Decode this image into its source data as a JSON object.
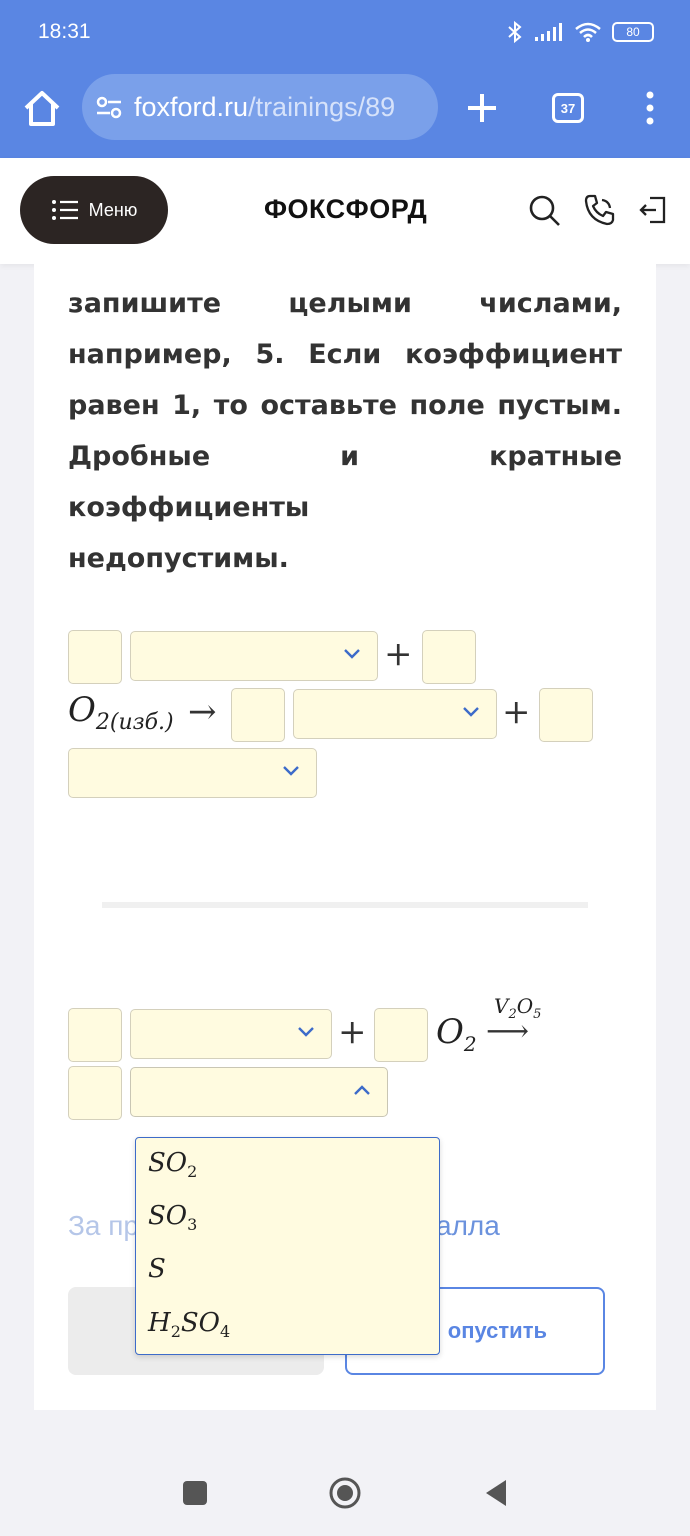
{
  "status_bar": {
    "time": "18:31",
    "battery": "80"
  },
  "browser": {
    "url_domain": "foxford.ru",
    "url_path": "/trainings/89",
    "tab_count": "37"
  },
  "header": {
    "menu_label": "Меню",
    "logo": "ФОКСФОРД"
  },
  "instruction": {
    "line1": "запишите целыми числами,",
    "line2": "например, 5. Если коэффициент",
    "line3": "равен 1, то оставьте поле пустым.",
    "line4": "Дробные и кратные коэффициенты",
    "line5": "недопустимы."
  },
  "equation1": {
    "plus": "+",
    "o2": "O",
    "o2_sub": "2(изб.)",
    "arrow": "→"
  },
  "equation2": {
    "plus": "+",
    "o2": "O",
    "o2_sub": "2",
    "catalyst": "V",
    "catalyst_sub1": "2",
    "catalyst_mid": "O",
    "catalyst_sub2": "5",
    "arrow": "⟶"
  },
  "footer": {
    "faded_text": "За пр",
    "faded_link": "алла",
    "skip_label": "опустить"
  },
  "dropdown": {
    "options": [
      {
        "base": "SO",
        "sub": "2"
      },
      {
        "base": "SO",
        "sub": "3"
      },
      {
        "base": "S",
        "sub": ""
      },
      {
        "pre": "H",
        "pre_sub": "2",
        "base": "SO",
        "sub": "4"
      }
    ]
  },
  "colors": {
    "accent": "#5a86e3",
    "input_bg": "#fffbe0",
    "menu_bg": "#2c2523"
  }
}
